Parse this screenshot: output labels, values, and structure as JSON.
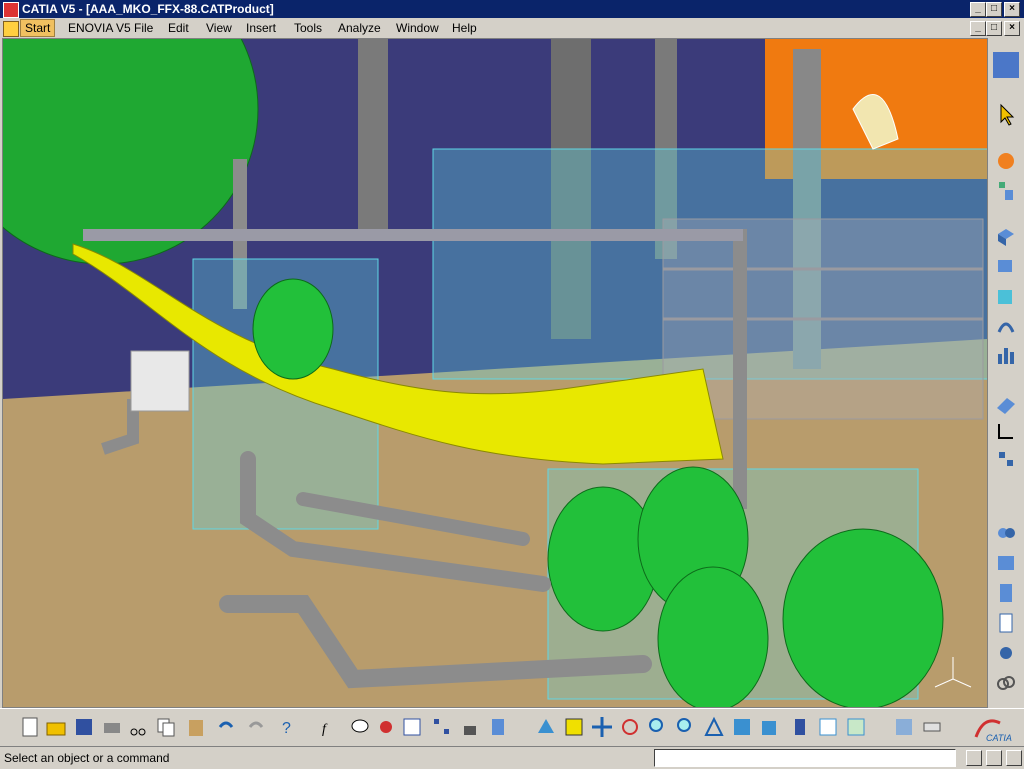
{
  "window": {
    "title": "CATIA V5 - [AAA_MKO_FFX-88.CATProduct]"
  },
  "menu": {
    "items": [
      "Start",
      "ENOVIA V5",
      "File",
      "Edit",
      "View",
      "Insert",
      "Tools",
      "Analyze",
      "Window",
      "Help"
    ]
  },
  "status": {
    "prompt": "Select an object or a command",
    "command_value": ""
  },
  "logo": {
    "text": "CATIA"
  },
  "colors": {
    "titlebar": "#0a246a",
    "duct": "#e8e800",
    "pipe": "#8c8c8c",
    "equipment_green": "#22c03a",
    "transparent_box": "#5fd7e6",
    "background_wall": "#3b3b7a",
    "floor": "#b89c6c",
    "orange_panel": "#f07a10"
  },
  "right_toolbar_icons": [
    "product-icon",
    "select-arrow-icon",
    "fly-icon",
    "tree-icon",
    "part-icon",
    "assembly-icon",
    "box-icon",
    "spring-icon",
    "analysis-icon",
    "eraser-icon",
    "sketch-icon",
    "constraint-icon",
    "route-icon",
    "equipment-icon",
    "catalog-icon",
    "report-icon",
    "satellite-icon",
    "link-icon"
  ],
  "bottom_toolbar_icons": [
    "new-icon",
    "open-icon",
    "save-icon",
    "print-icon",
    "cut-icon",
    "copy-icon",
    "paste-icon",
    "undo-icon",
    "redo-icon",
    "whats-this-icon",
    "formula-icon",
    "knowledge-icon",
    "macro-icon",
    "table-icon",
    "tree-expand-icon",
    "lock-icon",
    "hierarchy-icon",
    "fly-mode-icon",
    "fit-all-icon",
    "pan-icon",
    "rotate-icon",
    "zoom-in-icon",
    "zoom-out-icon",
    "normal-view-icon",
    "quick-view-icon",
    "view-mode-icon",
    "hide-show-icon",
    "swap-icon",
    "material-icon",
    "properties-icon",
    "measure-icon",
    "apply-icon"
  ]
}
